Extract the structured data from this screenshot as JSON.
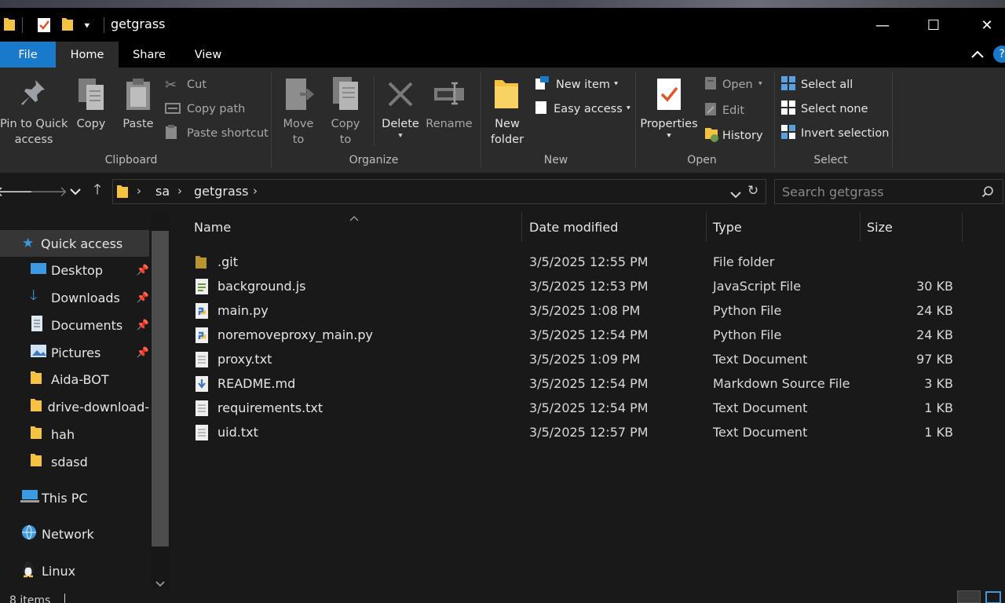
{
  "window": {
    "title": "getgrass",
    "controls": {
      "minimize": "—",
      "maximize": "☐",
      "close": "✕"
    }
  },
  "ribbon_tabs": [
    "File",
    "Home",
    "Share",
    "View"
  ],
  "ribbon": {
    "clipboard": {
      "group_label": "Clipboard",
      "pin_label_line1": "Pin to Quick",
      "pin_label_line2": "access",
      "copy_label": "Copy",
      "paste_label": "Paste",
      "cut_label": "Cut",
      "copy_path_label": "Copy path",
      "paste_shortcut_label": "Paste shortcut"
    },
    "organize": {
      "group_label": "Organize",
      "move_to_line1": "Move",
      "move_to_line2": "to",
      "copy_to_line1": "Copy",
      "copy_to_line2": "to",
      "delete_label": "Delete",
      "rename_label": "Rename"
    },
    "new": {
      "group_label": "New",
      "new_folder_line1": "New",
      "new_folder_line2": "folder",
      "new_item_label": "New item",
      "easy_access_label": "Easy access"
    },
    "open": {
      "group_label": "Open",
      "properties_label": "Properties",
      "open_label": "Open",
      "edit_label": "Edit",
      "history_label": "History"
    },
    "select": {
      "group_label": "Select",
      "select_all_label": "Select all",
      "select_none_label": "Select none",
      "invert_selection_label": "Invert selection"
    }
  },
  "address": {
    "breadcrumb": [
      "sa",
      "getgrass"
    ],
    "search_placeholder": "Search getgrass"
  },
  "nav": {
    "quick_access": "Quick access",
    "items": [
      {
        "label": "Desktop",
        "pinned": true,
        "icon": "desktop-icon"
      },
      {
        "label": "Downloads",
        "pinned": true,
        "icon": "download-icon"
      },
      {
        "label": "Documents",
        "pinned": true,
        "icon": "document-icon"
      },
      {
        "label": "Pictures",
        "pinned": true,
        "icon": "pictures-icon"
      },
      {
        "label": "Aida-BOT",
        "pinned": false,
        "icon": "folder-icon"
      },
      {
        "label": "drive-download-",
        "pinned": false,
        "icon": "folder-icon"
      },
      {
        "label": "hah",
        "pinned": false,
        "icon": "folder-icon"
      },
      {
        "label": "sdasd",
        "pinned": false,
        "icon": "folder-icon"
      }
    ],
    "this_pc": "This PC",
    "network": "Network",
    "linux": "Linux"
  },
  "columns": {
    "name": "Name",
    "date": "Date modified",
    "type": "Type",
    "size": "Size"
  },
  "files": [
    {
      "name": ".git",
      "date": "3/5/2025 12:55 PM",
      "type": "File folder",
      "size": "",
      "icon": "folder-icon"
    },
    {
      "name": "background.js",
      "date": "3/5/2025 12:53 PM",
      "type": "JavaScript File",
      "size": "30 KB",
      "icon": "js-file-icon"
    },
    {
      "name": "main.py",
      "date": "3/5/2025 1:08 PM",
      "type": "Python File",
      "size": "24 KB",
      "icon": "python-file-icon"
    },
    {
      "name": "noremoveproxy_main.py",
      "date": "3/5/2025 12:54 PM",
      "type": "Python File",
      "size": "24 KB",
      "icon": "python-file-icon"
    },
    {
      "name": "proxy.txt",
      "date": "3/5/2025 1:09 PM",
      "type": "Text Document",
      "size": "97 KB",
      "icon": "text-file-icon"
    },
    {
      "name": "README.md",
      "date": "3/5/2025 12:54 PM",
      "type": "Markdown Source File",
      "size": "3 KB",
      "icon": "markdown-file-icon"
    },
    {
      "name": "requirements.txt",
      "date": "3/5/2025 12:54 PM",
      "type": "Text Document",
      "size": "1 KB",
      "icon": "text-file-icon"
    },
    {
      "name": "uid.txt",
      "date": "3/5/2025 12:57 PM",
      "type": "Text Document",
      "size": "1 KB",
      "icon": "text-file-icon"
    }
  ],
  "status": {
    "item_count": "8 items"
  },
  "colors": {
    "accent": "#1979ca",
    "folder": "#f5c242",
    "background": "#191919",
    "ribbon": "#2b2b2b"
  }
}
